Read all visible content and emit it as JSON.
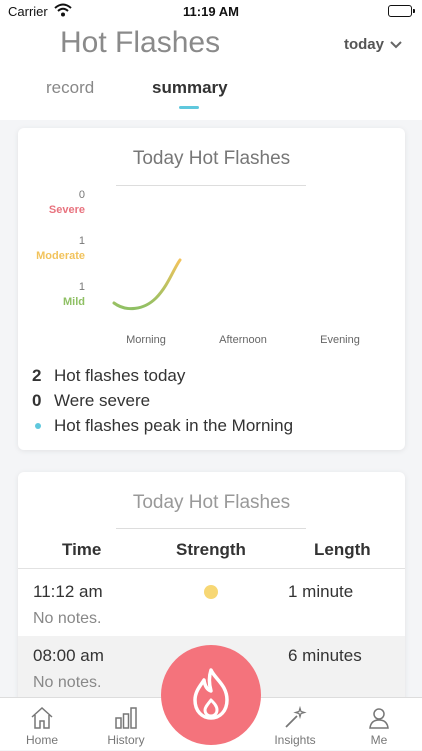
{
  "status_bar": {
    "carrier": "Carrier",
    "time": "11:19 AM"
  },
  "header": {
    "title": "Hot Flashes",
    "range": "today",
    "tabs": [
      {
        "label": "record"
      },
      {
        "label": "summary"
      }
    ],
    "active_tab": "summary"
  },
  "summary_card": {
    "title": "Today Hot Flashes",
    "stats": [
      {
        "value": "2",
        "label": "Hot flashes today"
      },
      {
        "value": "0",
        "label": "Were severe"
      },
      {
        "value": "",
        "label": "Hot flashes peak in the Morning"
      }
    ]
  },
  "chart_data": {
    "type": "line",
    "categories": [
      "Morning",
      "Afternoon",
      "Evening"
    ],
    "severity_levels": [
      {
        "label": "Severe",
        "count": "0",
        "color": "#e8737f"
      },
      {
        "label": "Moderate",
        "count": "1",
        "color": "#f2c35c"
      },
      {
        "label": "Mild",
        "count": "1",
        "color": "#8fc064"
      }
    ],
    "series": [
      {
        "values": [
          {
            "x": "Morning",
            "y": "Mild"
          },
          {
            "x": "Morning",
            "y": "Moderate"
          }
        ]
      }
    ],
    "grid": false,
    "legend": "none"
  },
  "detail_card": {
    "title": "Today Hot Flashes",
    "columns": [
      "Time",
      "Strength",
      "Length"
    ],
    "rows": [
      {
        "time": "11:12 am",
        "notes": "No notes.",
        "strength": "Moderate",
        "strength_color": "#f7d774",
        "length": "1 minute"
      },
      {
        "time": "08:00 am",
        "notes": "No notes.",
        "strength": "",
        "strength_color": "",
        "length": "6 minutes"
      }
    ]
  },
  "tab_bar": {
    "items": [
      {
        "label": "Home",
        "icon": "home-icon"
      },
      {
        "label": "History",
        "icon": "bar-chart-icon"
      },
      {
        "label": "Insights",
        "icon": "magic-wand-icon"
      },
      {
        "label": "Me",
        "icon": "person-icon"
      }
    ],
    "fab_icon": "flame-icon"
  },
  "colors": {
    "accent": "#5fc8dd",
    "fab": "#f4737c",
    "severe": "#e8737f",
    "moderate": "#f2c35c",
    "mild": "#8fc064"
  }
}
